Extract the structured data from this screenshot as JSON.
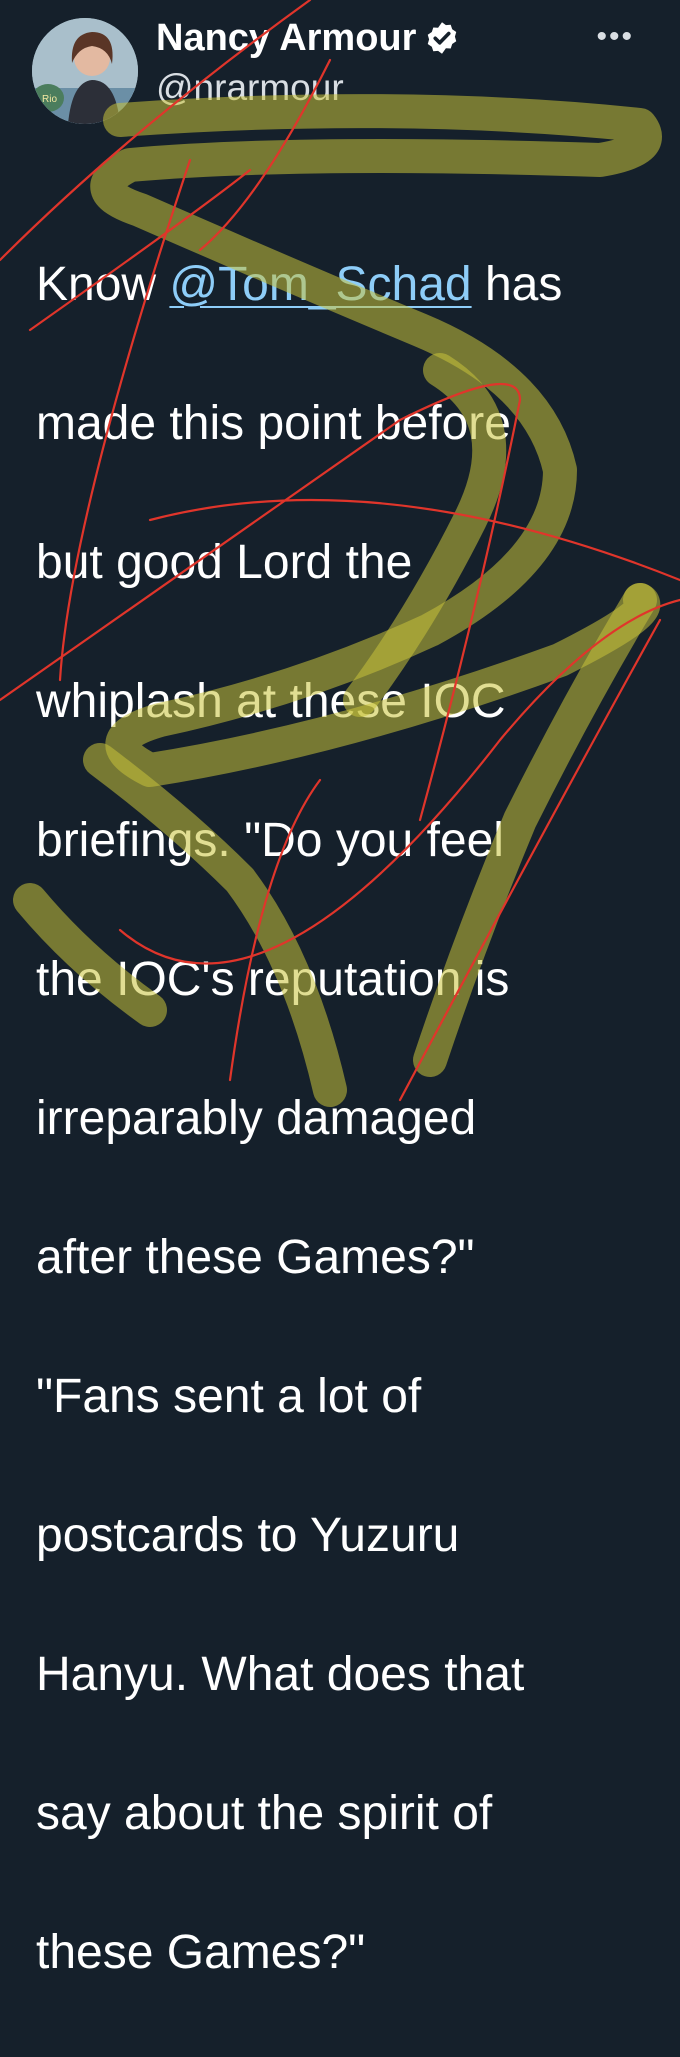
{
  "author": {
    "display_name": "Nancy Armour",
    "handle": "@nrarmour",
    "avatar_badge": "Rio",
    "verified_icon": "verified-check-icon"
  },
  "menu": {
    "more_label": "•••"
  },
  "tweet": {
    "line_0_before": "Know ",
    "mention": "@Tom_Schad",
    "line_0_after": " has",
    "lines": [
      "made this point before",
      "but good Lord the",
      "whiplash at these IOC",
      "briefings. \"Do you feel",
      "the IOC's reputation is",
      "irreparably damaged",
      "after these Games?\"",
      "\"Fans sent a lot of",
      "postcards to Yuzuru",
      "Hanyu. What does that",
      "say about the spirit of",
      "these Games?\""
    ]
  },
  "colors": {
    "background": "#15202b",
    "link": "#8ecdf8",
    "highlighter": "#c9c23a",
    "pen": "#e0352b"
  }
}
